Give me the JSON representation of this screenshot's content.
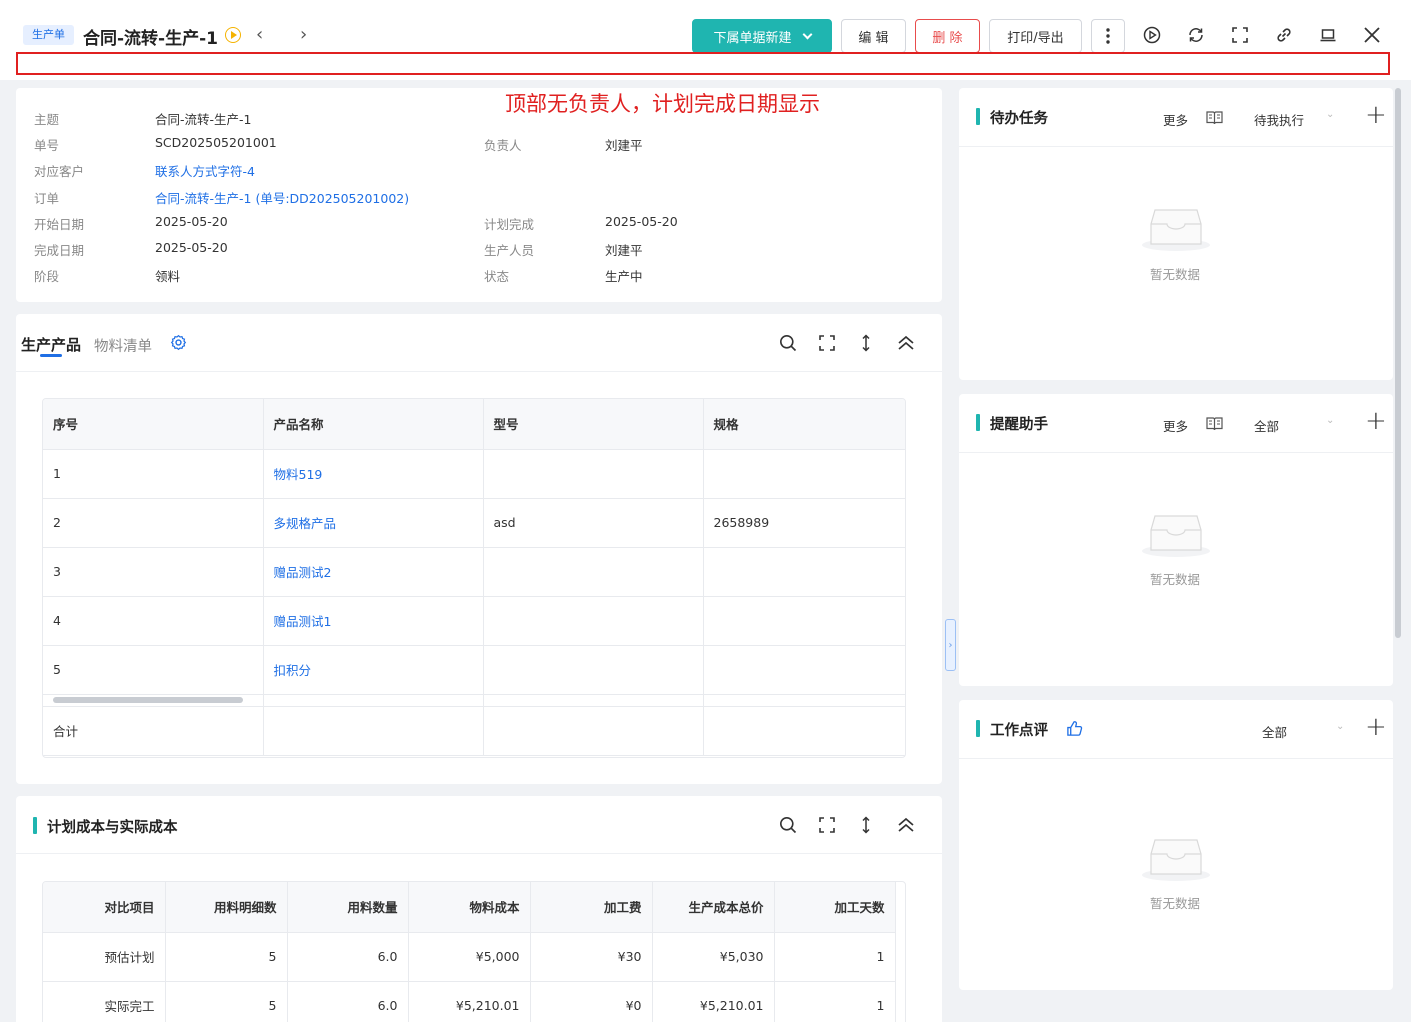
{
  "header": {
    "badge": "生产单",
    "title": "合同-流转-生产-1",
    "btn_new": "下属单据新建",
    "btn_edit": "编 辑",
    "btn_delete": "删 除",
    "btn_print": "打印/导出"
  },
  "annotation": "顶部无负责人，计划完成日期显示",
  "info": {
    "subject_label": "主题",
    "subject": "合同-流转-生产-1",
    "no_label": "单号",
    "no": "SCD202505201001",
    "owner_label": "负责人",
    "owner": "刘建平",
    "customer_label": "对应客户",
    "customer": "联系人方式字符-4",
    "order_label": "订单",
    "order": "合同-流转-生产-1 (单号:DD202505201002)",
    "start_label": "开始日期",
    "start": "2025-05-20",
    "plan_done_label": "计划完成",
    "plan_done": "2025-05-20",
    "done_label": "完成日期",
    "done": "2025-05-20",
    "producer_label": "生产人员",
    "producer": "刘建平",
    "stage_label": "阶段",
    "stage": "领料",
    "status_label": "状态",
    "status": "生产中"
  },
  "product": {
    "tab_active": "生产产品",
    "tab_other": "物料清单",
    "columns": [
      "序号",
      "产品名称",
      "型号",
      "规格"
    ],
    "rows": [
      [
        "1",
        "物料519",
        "",
        ""
      ],
      [
        "2",
        "多规格产品",
        "asd",
        "2658989"
      ],
      [
        "3",
        "赠品测试2",
        "",
        ""
      ],
      [
        "4",
        "赠品测试1",
        "",
        ""
      ],
      [
        "5",
        "扣积分",
        "",
        ""
      ]
    ],
    "total_label": "合计"
  },
  "cost": {
    "title": "计划成本与实际成本",
    "columns": [
      "对比项目",
      "用料明细数",
      "用料数量",
      "物料成本",
      "加工费",
      "生产成本总价",
      "加工天数"
    ],
    "rows": [
      [
        "预估计划",
        "5",
        "6.0",
        "¥5,000",
        "¥30",
        "¥5,030",
        "1"
      ],
      [
        "实际完工",
        "5",
        "6.0",
        "¥5,210.01",
        "¥0",
        "¥5,210.01",
        "1"
      ]
    ]
  },
  "side": {
    "todo": {
      "title": "待办任务",
      "more": "更多",
      "filter": "待我执行",
      "empty": "暂无数据"
    },
    "remind": {
      "title": "提醒助手",
      "more": "更多",
      "filter": "全部",
      "empty": "暂无数据"
    },
    "review": {
      "title": "工作点评",
      "filter": "全部",
      "empty": "暂无数据"
    }
  },
  "colors": {
    "primary": "#1fb5b0",
    "link": "#1f6fe5",
    "danger": "#e84c4c",
    "annotation": "#e02020"
  }
}
